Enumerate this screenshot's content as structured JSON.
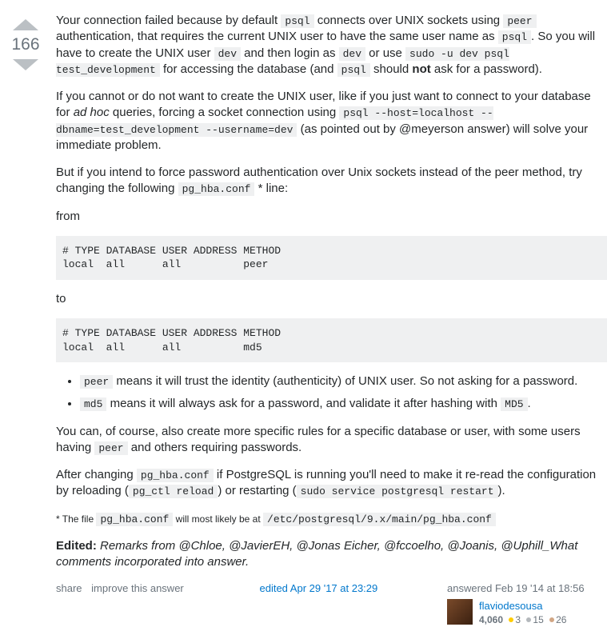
{
  "vote": {
    "count": "166"
  },
  "para1": {
    "t1": "Your connection failed because by default ",
    "c1": "psql",
    "t2": " connects over UNIX sockets using ",
    "c2": "peer",
    "t3": " authentication, that requires the current UNIX user to have the same user name as ",
    "c3": "psql",
    "t4": ". So you will have to create the UNIX user ",
    "c4": "dev",
    "t5": " and then login as ",
    "c5": "dev",
    "t6": " or use ",
    "c6": "sudo -u dev psql test_development",
    "t7": " for accessing the database (and ",
    "c7": "psql",
    "t8": " should ",
    "b1": "not",
    "t9": " ask for a password)."
  },
  "para2": {
    "t1": "If you cannot or do not want to create the UNIX user, like if you just want to connect to your database for ",
    "e1": "ad hoc",
    "t2": " queries, forcing a socket connection using ",
    "c1": "psql --host=localhost --dbname=test_development --username=dev",
    "t3": " (as pointed out by @meyerson answer) will solve your immediate problem."
  },
  "para3": {
    "t1": "But if you intend to force password authentication over Unix sockets instead of the peer method, try changing the following ",
    "c1": "pg_hba.conf",
    "t2": " * line:"
  },
  "labels": {
    "from": "from",
    "to": "to"
  },
  "code_from": "# TYPE DATABASE USER ADDRESS METHOD\nlocal  all      all          peer",
  "code_to": "# TYPE DATABASE USER ADDRESS METHOD\nlocal  all      all          md5",
  "bullet1": {
    "c1": "peer",
    "t1": " means it will trust the identity (authenticity) of UNIX user. So not asking for a password."
  },
  "bullet2": {
    "c1": "md5",
    "t1": " means it will always ask for a password, and validate it after hashing with ",
    "c2": "MD5",
    "t2": "."
  },
  "para4": {
    "t1": "You can, of course, also create more specific rules for a specific database or user, with some users having ",
    "c1": "peer",
    "t2": " and others requiring passwords."
  },
  "para5": {
    "t1": "After changing ",
    "c1": "pg_hba.conf",
    "t2": " if PostgreSQL is running you'll need to make it re-read the configuration by reloading (",
    "c2": "pg_ctl reload",
    "t3": ") or restarting (",
    "c3": "sudo service postgresql restart",
    "t4": ")."
  },
  "note": {
    "t1": "* The file ",
    "c1": "pg_hba.conf",
    "t2": " will most likely be at ",
    "c2": "/etc/postgresql/9.x/main/pg_hba.conf"
  },
  "edited_para": {
    "b1": "Edited:",
    "e1": " Remarks from @Chloe, @JavierEH, @Jonas Eicher, @fccoelho, @Joanis, @Uphill_What comments incorporated into answer."
  },
  "menu": {
    "share": "share",
    "improve": "improve this answer",
    "edited": "edited Apr 29 '17 at 23:29",
    "answered": "answered Feb 19 '14 at 18:56"
  },
  "user": {
    "name": "flaviodesousa",
    "rep": "4,060",
    "gold": "3",
    "silver": "15",
    "bronze": "26"
  }
}
